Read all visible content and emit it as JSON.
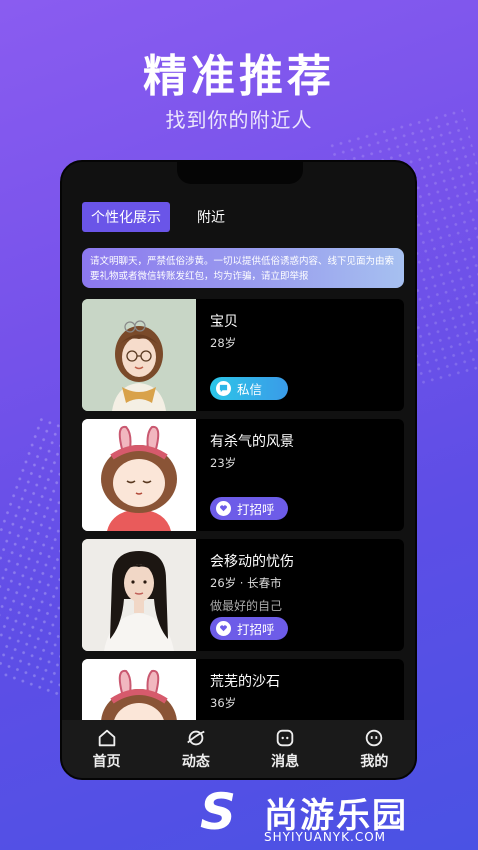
{
  "promo": {
    "headline": "精准推荐",
    "subline": "找到你的附近人"
  },
  "tabs": [
    {
      "label": "个性化展示",
      "active": true
    },
    {
      "label": "附近",
      "active": false
    }
  ],
  "notice": "请文明聊天，严禁低俗涉黄。一切以提供低俗诱惑内容、线下见面为由索要礼物或者微信转账发红包，均为诈骗，请立即举报",
  "cards": [
    {
      "name": "宝贝",
      "age": "28岁",
      "signature": "",
      "button": "私信",
      "button_type": "message"
    },
    {
      "name": "有杀气的风景",
      "age": "23岁",
      "signature": "",
      "button": "打招呼",
      "button_type": "greet"
    },
    {
      "name": "会移动的忧伤",
      "age": "26岁 · 长春市",
      "signature": "做最好的自己",
      "button": "打招呼",
      "button_type": "greet"
    },
    {
      "name": "荒芜的沙石",
      "age": "36岁",
      "signature": "",
      "button": "",
      "button_type": ""
    }
  ],
  "bottom_nav": [
    {
      "label": "首页",
      "icon": "home-icon"
    },
    {
      "label": "动态",
      "icon": "planet-icon"
    },
    {
      "label": "消息",
      "icon": "message-icon"
    },
    {
      "label": "我的",
      "icon": "profile-icon"
    }
  ],
  "watermark": {
    "logo_letter": "S",
    "brand": "尚游乐园",
    "url": "SHYIYUANYK.COM"
  },
  "colors": {
    "background_start": "#8a5cf0",
    "background_end": "#4a52e4",
    "accent": "#6a55e8",
    "message_button": "#2cc6e8",
    "greet_button": "#6d5ce8"
  }
}
